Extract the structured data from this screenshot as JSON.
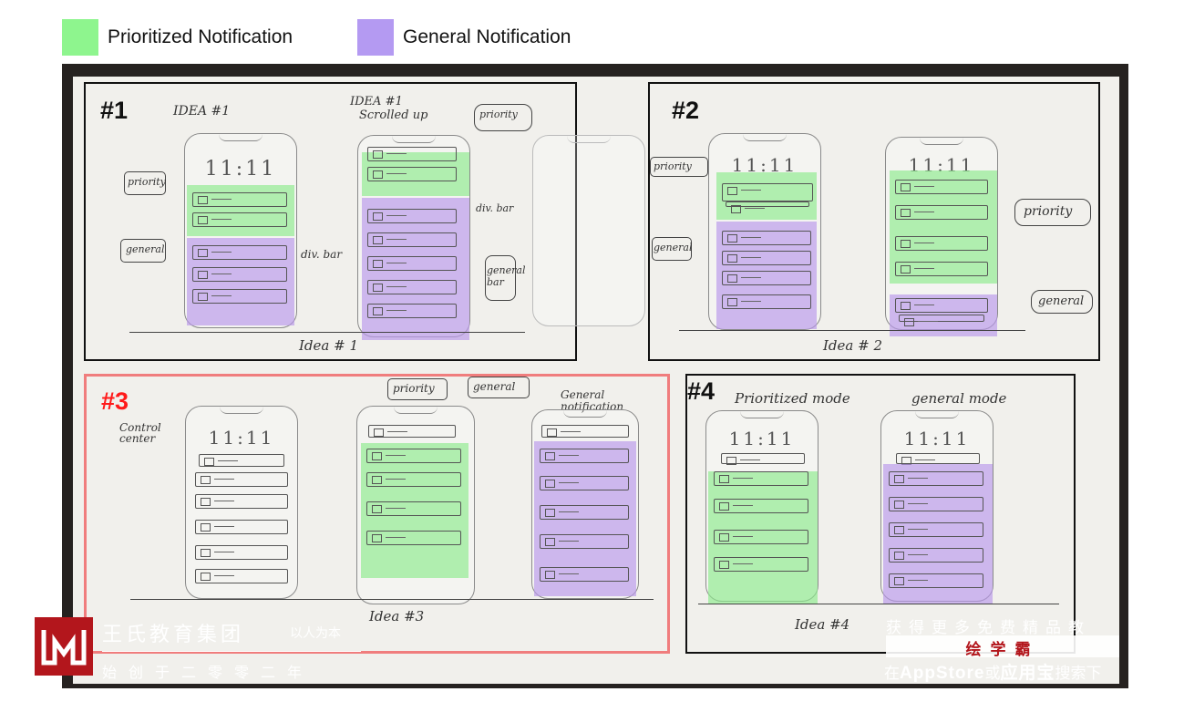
{
  "legend": {
    "prioritized": {
      "label": "Prioritized Notification",
      "color": "#8ef58e"
    },
    "general": {
      "label": "General Notification",
      "color": "#b49af2"
    }
  },
  "ideas": {
    "idea1": {
      "label": "#1",
      "notes": [
        "IDEA #1",
        "IDEA #1",
        "Scrolled up",
        "priority",
        "general",
        "priority",
        "div. bar",
        "div. bar",
        "general bar"
      ],
      "times": [
        "11:11"
      ],
      "caption": "Idea # 1"
    },
    "idea2": {
      "label": "#2",
      "notes": [
        "priority",
        "general",
        "priority",
        "general"
      ],
      "times": [
        "11:11",
        "11:11"
      ],
      "caption": "Idea # 2"
    },
    "idea3": {
      "label": "#3",
      "label_color": "#ff1a1a",
      "notes": [
        "Control center",
        "priority",
        "general",
        "General notification"
      ],
      "times": [
        "11:11"
      ],
      "caption": "Idea #3"
    },
    "idea4": {
      "label": "#4",
      "notes": [
        "Prioritized mode",
        "general mode"
      ],
      "times": [
        "11:11",
        "11:11"
      ],
      "caption": "Idea #4"
    }
  },
  "watermark": {
    "org": "王氏教育集团",
    "slogan": "以人为本",
    "founded": "始创于二零零二年",
    "ad_line1": "获得更多免费精品教",
    "ad_brand": "绘学霸",
    "ad_line2_pre": "在",
    "ad_line2_store": "AppStore",
    "ad_line2_mid": "或",
    "ad_line2_alt": "应用宝",
    "ad_line2_post": "搜索下"
  }
}
